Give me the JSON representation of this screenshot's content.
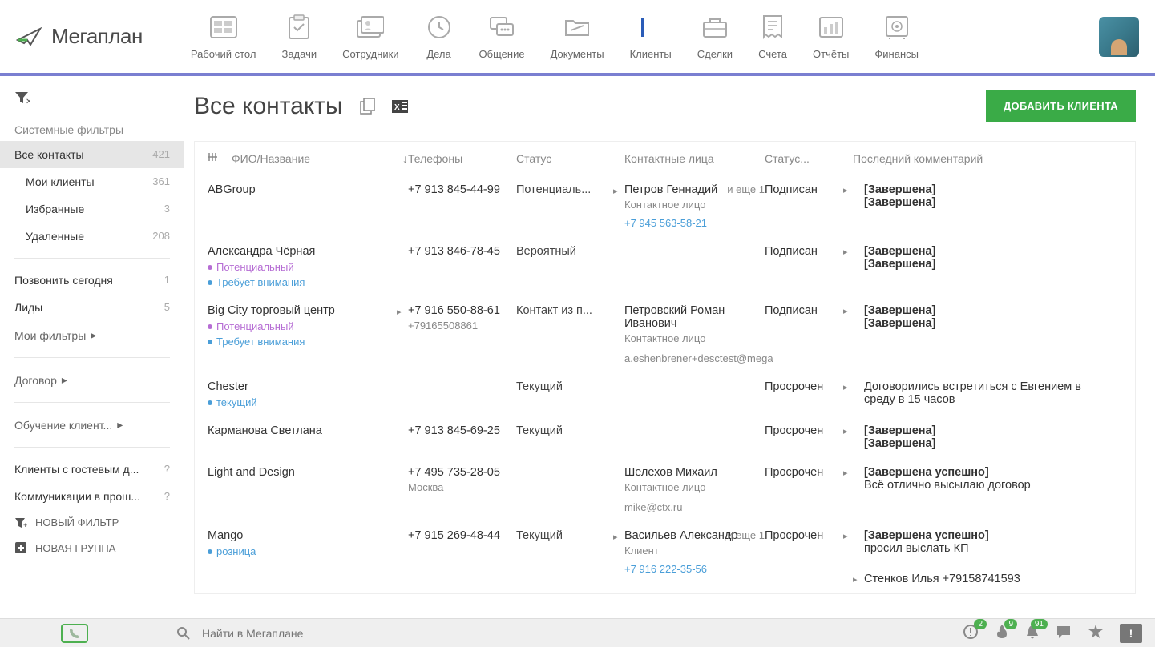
{
  "logo": "Мегаплан",
  "nav": [
    {
      "label": "Рабочий стол"
    },
    {
      "label": "Задачи"
    },
    {
      "label": "Сотрудники"
    },
    {
      "label": "Дела"
    },
    {
      "label": "Общение"
    },
    {
      "label": "Документы"
    },
    {
      "label": "Клиенты"
    },
    {
      "label": "Сделки"
    },
    {
      "label": "Счета"
    },
    {
      "label": "Отчёты"
    },
    {
      "label": "Финансы"
    }
  ],
  "page_title": "Все контакты",
  "add_button": "ДОБАВИТЬ КЛИЕНТА",
  "sidebar": {
    "system_filters_label": "Системные фильтры",
    "items": [
      {
        "label": "Все контакты",
        "count": "421"
      },
      {
        "label": "Мои клиенты",
        "count": "361"
      },
      {
        "label": "Избранные",
        "count": "3"
      },
      {
        "label": "Удаленные",
        "count": "208"
      }
    ],
    "user_filters": [
      {
        "label": "Позвонить сегодня",
        "count": "1"
      },
      {
        "label": "Лиды",
        "count": "5"
      }
    ],
    "my_filters_label": "Мои фильтры",
    "groups": [
      {
        "label": "Договор"
      },
      {
        "label": "Обучение клиент..."
      }
    ],
    "guest_filters": [
      {
        "label": "Клиенты с гостевым д...",
        "count": "?"
      },
      {
        "label": "Коммуникации в прош...",
        "count": "?"
      }
    ],
    "new_filter": "НОВЫЙ ФИЛЬТР",
    "new_group": "НОВАЯ ГРУППА"
  },
  "columns": {
    "name": "ФИО/Название",
    "phone": "Телефоны",
    "status": "Статус",
    "contact": "Контактные лица",
    "status2": "Статус...",
    "comment": "Последний комментарий"
  },
  "rows": [
    {
      "name": "ABGroup",
      "phone": "+7 913 845-44-99",
      "status": "Потенциаль...",
      "contact_name": "Петров Геннадий",
      "contact_extra": "и еще 1",
      "contact_role": "Контактное лицо",
      "contact_phone": "+7 945 563-58-21",
      "status2": "Подписан",
      "comment1": "[Завершена]",
      "comment2": "[Завершена]"
    },
    {
      "name": "Александра Чёрная",
      "tag1": "Потенциальный",
      "tag2": "Требует внимания",
      "phone": "+7 913 846-78-45",
      "status": "Вероятный",
      "status2": "Подписан",
      "comment1": "[Завершена]",
      "comment2": "[Завершена]"
    },
    {
      "name": "Big City торговый центр",
      "tag1": "Потенциальный",
      "tag2": "Требует внимания",
      "phone": "+7 916 550-88-61",
      "phone2": "+79165508861",
      "status": "Контакт из п...",
      "contact_name": "Петровский Роман Иванович",
      "contact_role": "Контактное лицо",
      "contact_email": "a.eshenbrener+desctest@mega",
      "status2": "Подписан",
      "comment1": "[Завершена]",
      "comment2": "[Завершена]"
    },
    {
      "name": "Chester",
      "tag_blue": "текущий",
      "status": "Текущий",
      "status2": "Просрочен",
      "comment_text": "Договорились встретиться с Евгением в среду в 15 часов"
    },
    {
      "name": "Карманова Светлана",
      "phone": "+7 913 845-69-25",
      "status": "Текущий",
      "status2": "Просрочен",
      "comment1": "[Завершена]",
      "comment2": "[Завершена]"
    },
    {
      "name": "Light and Design",
      "phone": "+7 495 735-28-05",
      "phone_city": "Москва",
      "contact_name": "Шелехов Михаил",
      "contact_role": "Контактное лицо",
      "contact_email": "mike@ctx.ru",
      "status2": "Просрочен",
      "comment1": "[Завершена успешно]",
      "comment_text": "Всё отлично высылаю договор"
    },
    {
      "name": "Mango",
      "tag_blue": "розница",
      "phone": "+7 915 269-48-44",
      "status": "Текущий",
      "contact_name": "Васильев Александр",
      "contact_extra": "и еще 1",
      "contact_role": "Клиент",
      "contact_phone": "+7 916 222-35-56",
      "status2": "Просрочен",
      "comment1": "[Завершена успешно]",
      "comment_text": "просил выслать КП",
      "comment_extra": "Стенков Илья +79158741593"
    }
  ],
  "search_placeholder": "Найти в Мегаплане",
  "badges": {
    "alert": "2",
    "fire": "9",
    "bell": "91"
  }
}
